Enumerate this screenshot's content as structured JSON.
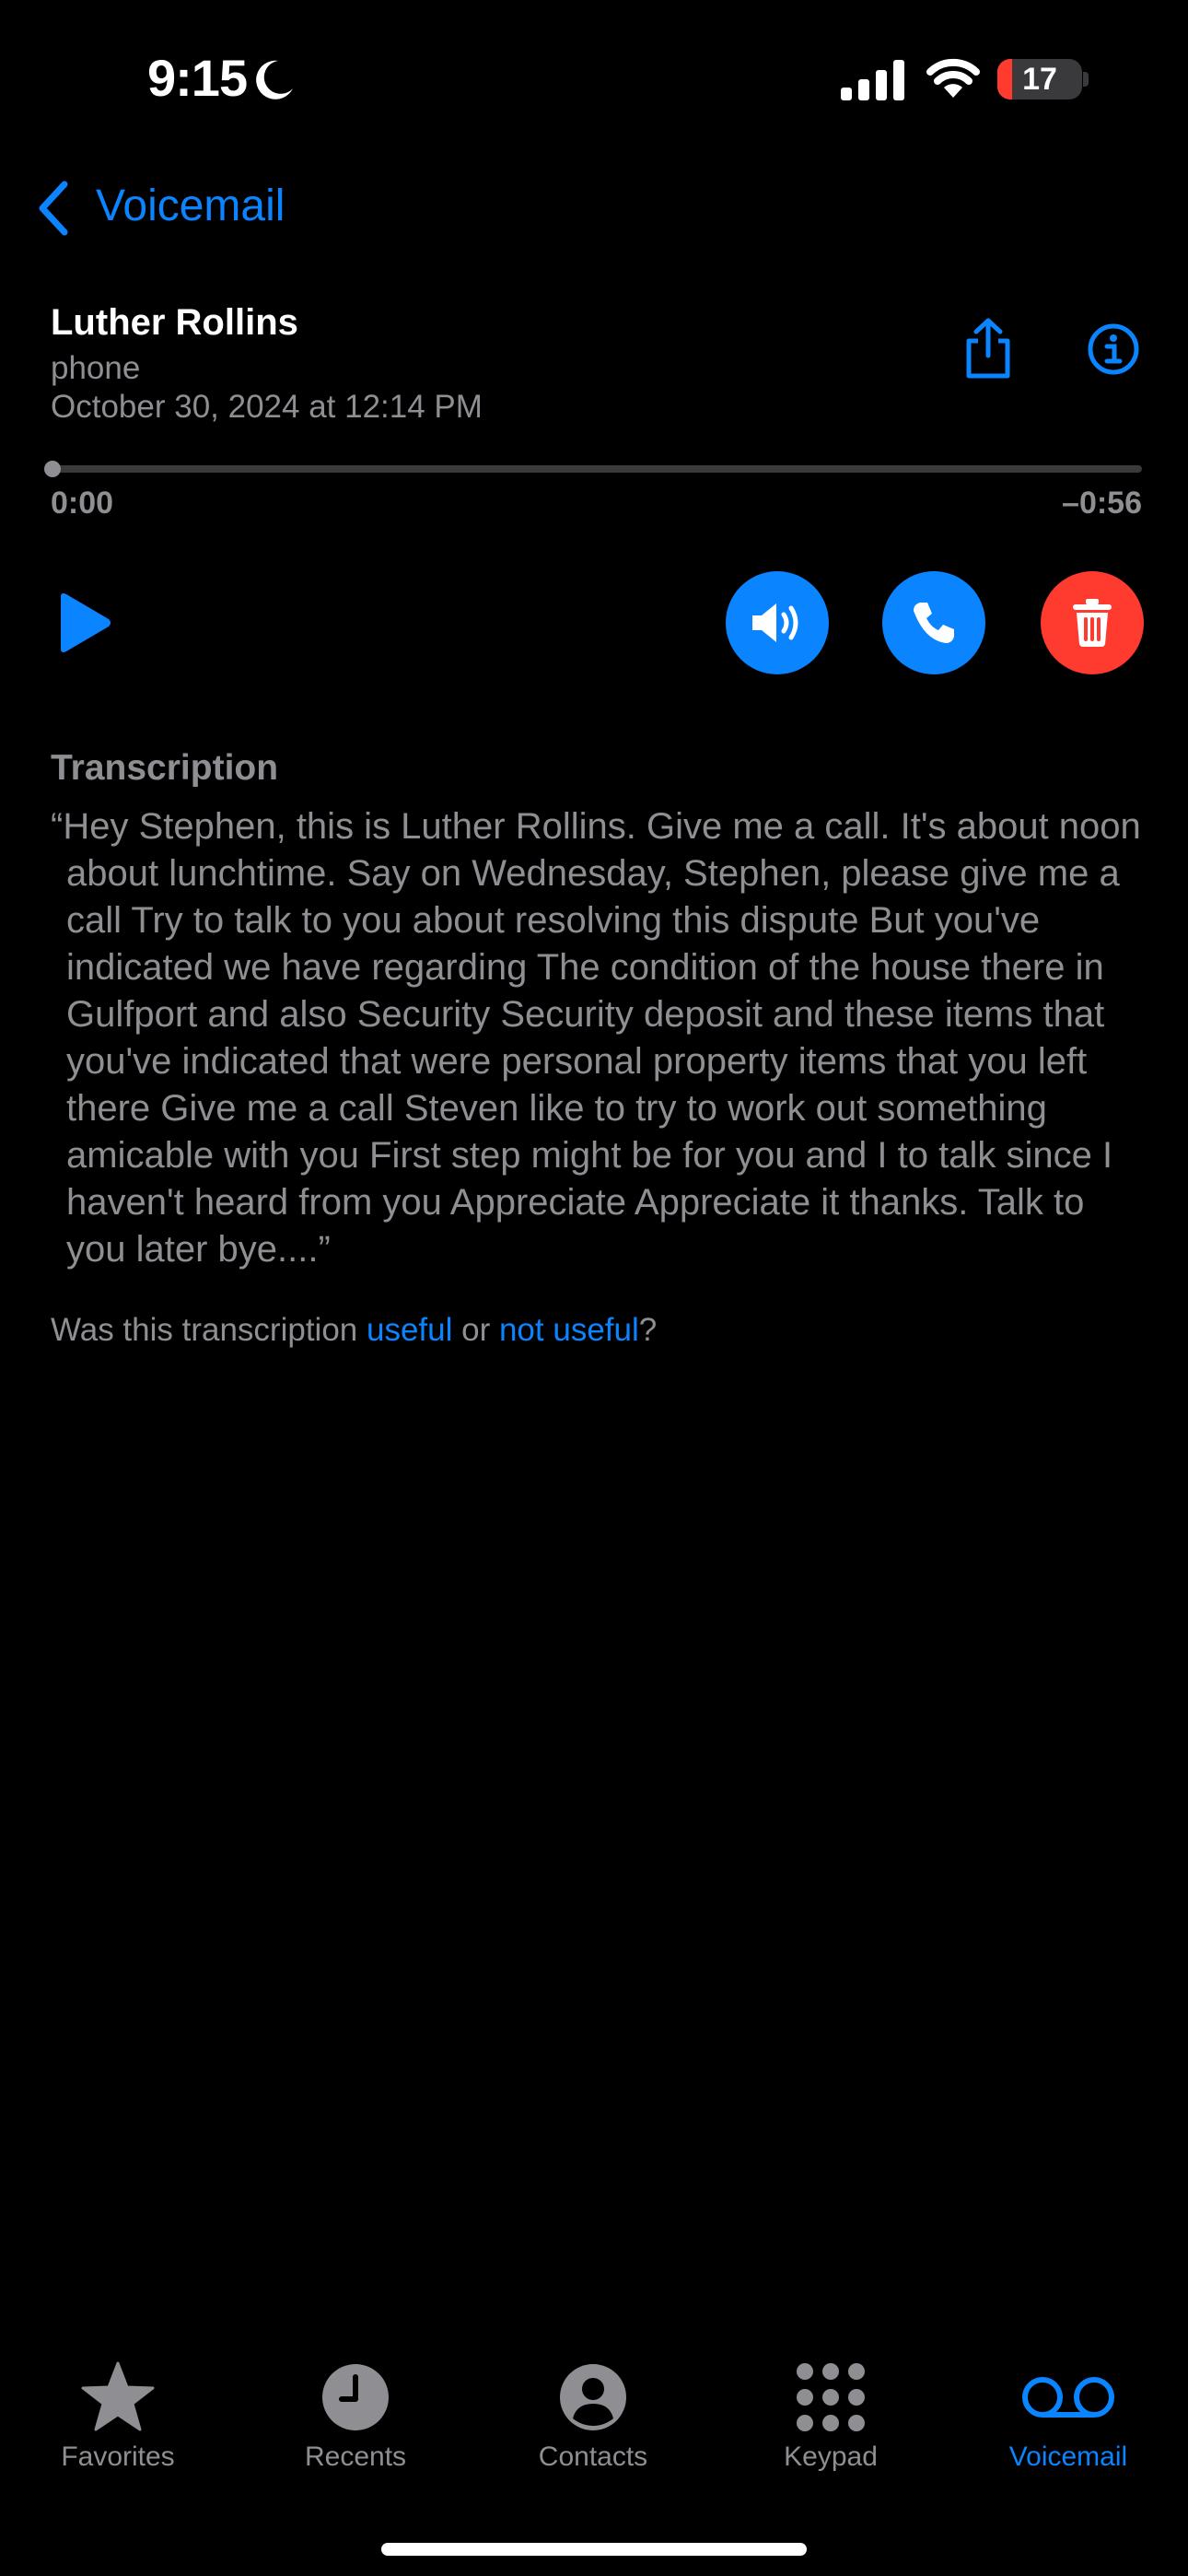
{
  "status_bar": {
    "time": "9:15",
    "battery": "17",
    "battery_level": 0.17
  },
  "nav": {
    "back_label": "Voicemail"
  },
  "voicemail": {
    "name": "Luther Rollins",
    "type": "phone",
    "date": "October 30, 2024 at 12:14 PM",
    "elapsed": "0:00",
    "remaining": "–0:56",
    "progress": 0
  },
  "transcription": {
    "title": "Transcription",
    "text": "“Hey Stephen, this is Luther Rollins. Give me a call. It's about noon about lunchtime. Say on Wednesday, Stephen, please give me a call Try to talk to you about resolving this dispute But you've indicated we have regarding The condition of the house there in Gulfport and also Security Security deposit and these items that you've indicated that were personal property items that you left there Give me a call Steven like to try to work out something amicable with you First step might be for you and I to talk since I haven't heard from you Appreciate Appreciate it thanks. Talk to you later bye....”",
    "feedback_prefix": "Was this transcription ",
    "feedback_useful": "useful",
    "feedback_or": " or ",
    "feedback_not_useful": "not useful",
    "feedback_suffix": "?"
  },
  "tabs": [
    {
      "label": "Favorites",
      "icon": "star-icon"
    },
    {
      "label": "Recents",
      "icon": "clock-icon"
    },
    {
      "label": "Contacts",
      "icon": "person-circle-icon"
    },
    {
      "label": "Keypad",
      "icon": "keypad-icon"
    },
    {
      "label": "Voicemail",
      "icon": "voicemail-icon",
      "active": true
    }
  ],
  "colors": {
    "accent": "#0a84ff",
    "delete": "#ff3b30",
    "secondary_text": "#8e8e93"
  }
}
